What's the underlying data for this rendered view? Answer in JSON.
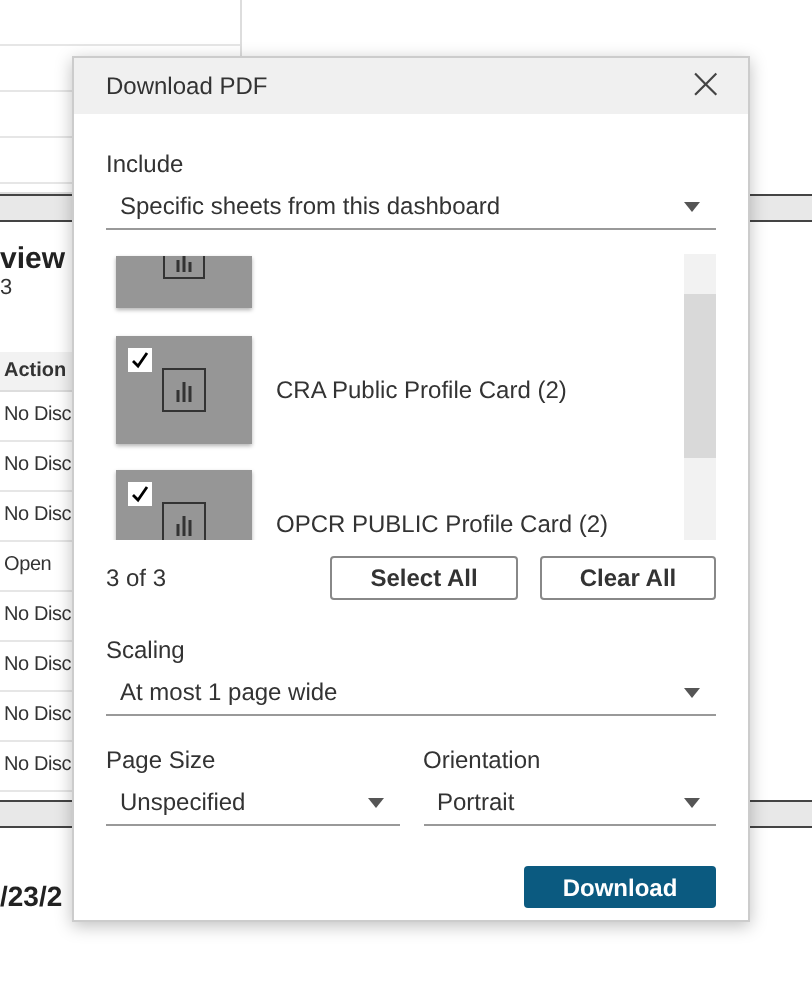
{
  "background": {
    "heading": "view",
    "subheading": "3",
    "column_header": "Action",
    "cells": [
      "No Disc",
      "No Disc",
      "No Disc",
      "Open",
      "No Disc",
      "No Disc",
      "No Disc",
      "No Disc"
    ],
    "date": "/23/2"
  },
  "dialog": {
    "title": "Download PDF",
    "close": "×",
    "include": {
      "label": "Include",
      "value": "Specific sheets from this dashboard"
    },
    "sheets": [
      {
        "kind": "clipped"
      },
      {
        "kind": "sheet",
        "label": "CRA Public Profile Card (2)",
        "checked": true
      },
      {
        "kind": "sheet",
        "label": "OPCR PUBLIC Profile Card (2)",
        "checked": true
      }
    ],
    "count": "3 of 3",
    "select_all": "Select All",
    "clear_all": "Clear All",
    "scaling": {
      "label": "Scaling",
      "value": "At most 1 page wide"
    },
    "page_size": {
      "label": "Page Size",
      "value": "Unspecified"
    },
    "orientation": {
      "label": "Orientation",
      "value": "Portrait"
    },
    "download": "Download"
  }
}
